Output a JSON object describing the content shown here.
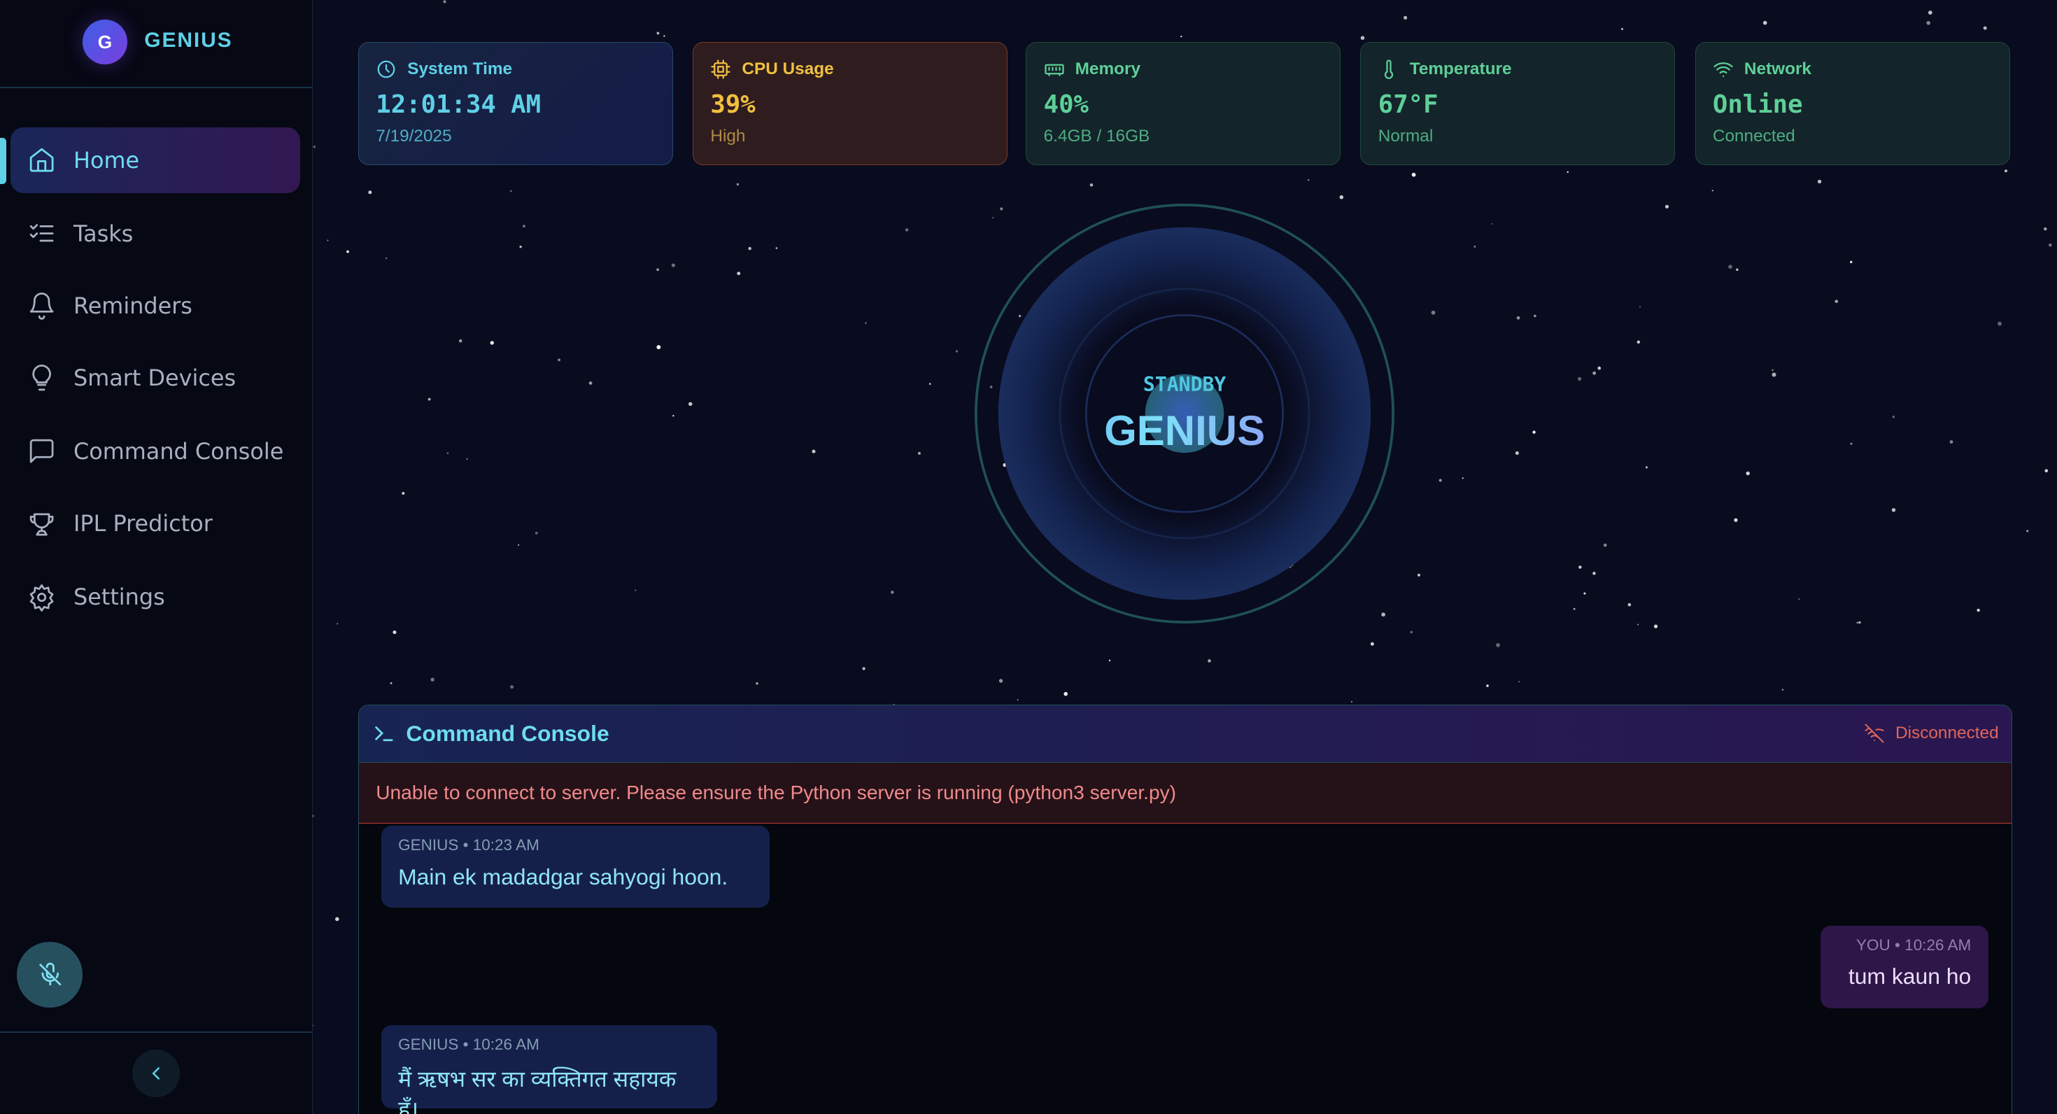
{
  "app": {
    "brand": "GENIUS",
    "logo_letter": "G"
  },
  "sidebar": {
    "items": [
      {
        "label": "Home",
        "icon": "home-icon",
        "active": true
      },
      {
        "label": "Tasks",
        "icon": "checklist-icon"
      },
      {
        "label": "Reminders",
        "icon": "bell-icon"
      },
      {
        "label": "Smart Devices",
        "icon": "lightbulb-icon"
      },
      {
        "label": "Command Console",
        "icon": "message-square-icon"
      },
      {
        "label": "IPL Predictor",
        "icon": "trophy-icon"
      },
      {
        "label": "Settings",
        "icon": "gear-icon"
      }
    ],
    "mic_icon": "mic-off-icon",
    "collapse_icon": "chevron-left-icon"
  },
  "stats": {
    "time": {
      "label": "System Time",
      "value": "12:01:34 AM",
      "sub": "7/19/2025"
    },
    "cpu": {
      "label": "CPU Usage",
      "value": "39%",
      "sub": "High"
    },
    "memory": {
      "label": "Memory",
      "value": "40%",
      "sub": "6.4GB / 16GB"
    },
    "temperature": {
      "label": "Temperature",
      "value": "67°F",
      "sub": "Normal"
    },
    "network": {
      "label": "Network",
      "value": "Online",
      "sub": "Connected"
    }
  },
  "orb": {
    "status": "STANDBY",
    "name": "GENIUS"
  },
  "console": {
    "title": "Command Console",
    "status": "Disconnected",
    "error": "Unable to connect to server. Please ensure the Python server is running (python3 server.py)",
    "messages": [
      {
        "sender": "GENIUS",
        "meta": "GENIUS • 10:23 AM",
        "text": "Main ek madadgar sahyogi hoon."
      },
      {
        "sender": "YOU",
        "meta": "YOU • 10:26 AM",
        "text": "tum kaun ho"
      },
      {
        "sender": "GENIUS",
        "meta": "GENIUS • 10:26 AM",
        "text": "मैं ऋषभ सर का व्यक्तिगत सहायक हूँ।"
      }
    ]
  },
  "colors": {
    "accent": "#5fd0e6",
    "error": "#e0665a",
    "cpu": "#f0c040",
    "ok": "#5fcf98"
  }
}
